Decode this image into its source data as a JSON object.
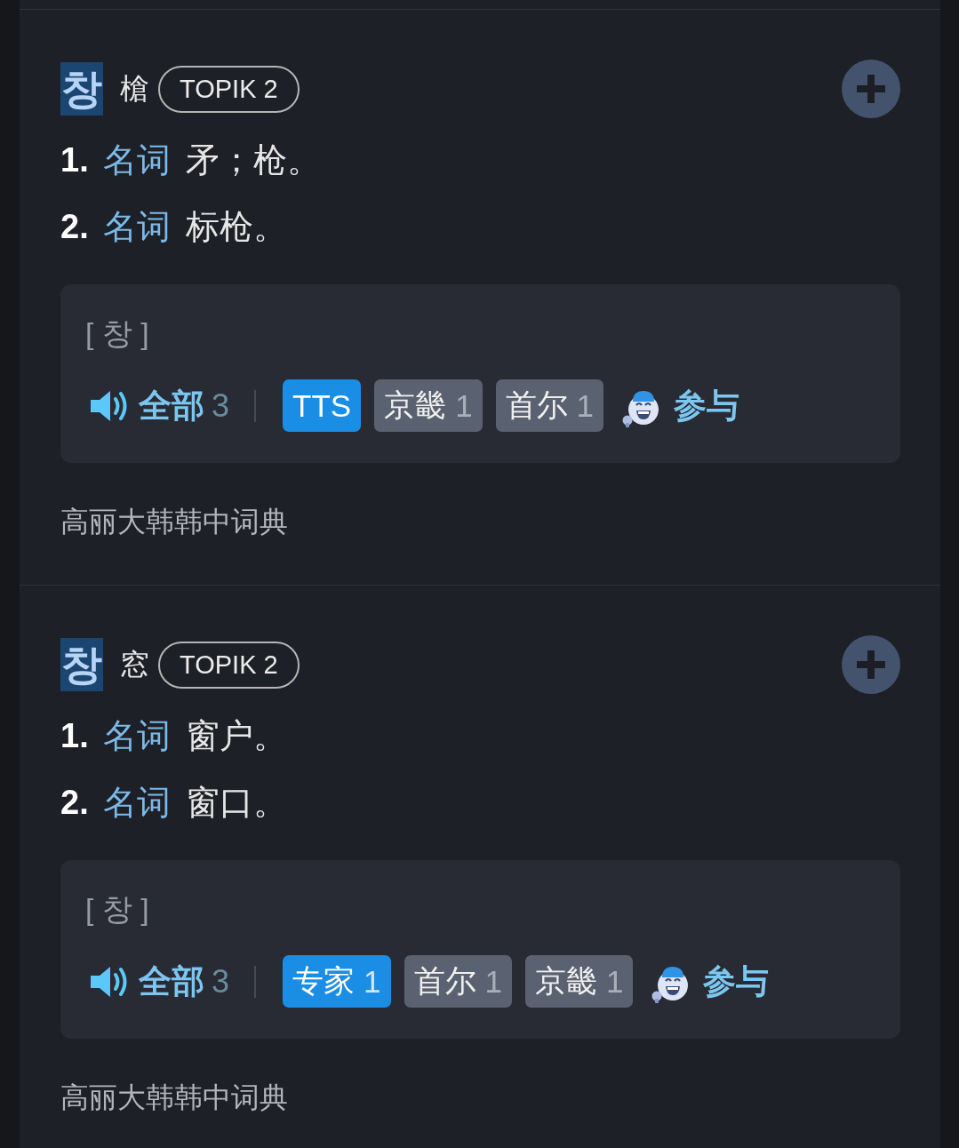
{
  "entries": [
    {
      "headword": "창",
      "highlighted": true,
      "hanja": "槍",
      "level": "TOPIK 2",
      "senses": [
        {
          "number": "1.",
          "pos": "名词",
          "definition": "矛；枪。"
        },
        {
          "number": "2.",
          "pos": "名词",
          "definition": "标枪。"
        }
      ],
      "pronunciation": "[ 창 ]",
      "audio": {
        "label": "全部",
        "count": "3"
      },
      "voices": [
        {
          "label": "TTS",
          "selected": true
        },
        {
          "label": "京畿",
          "count": "1",
          "selected": false
        },
        {
          "label": "首尔",
          "count": "1",
          "selected": false
        }
      ],
      "participate": "参与",
      "source": "高丽大韩韩中词典"
    },
    {
      "headword": "창",
      "highlighted": true,
      "hanja": "窓",
      "level": "TOPIK 2",
      "senses": [
        {
          "number": "1.",
          "pos": "名词",
          "definition": "窗户。"
        },
        {
          "number": "2.",
          "pos": "名词",
          "definition": "窗口。"
        }
      ],
      "pronunciation": "[ 창 ]",
      "audio": {
        "label": "全部",
        "count": "3"
      },
      "voices": [
        {
          "label": "专家",
          "count": "1",
          "selected": true
        },
        {
          "label": "首尔",
          "count": "1",
          "selected": false
        },
        {
          "label": "京畿",
          "count": "1",
          "selected": false
        }
      ],
      "participate": "参与",
      "source": "高丽大韩韩中词典"
    }
  ]
}
